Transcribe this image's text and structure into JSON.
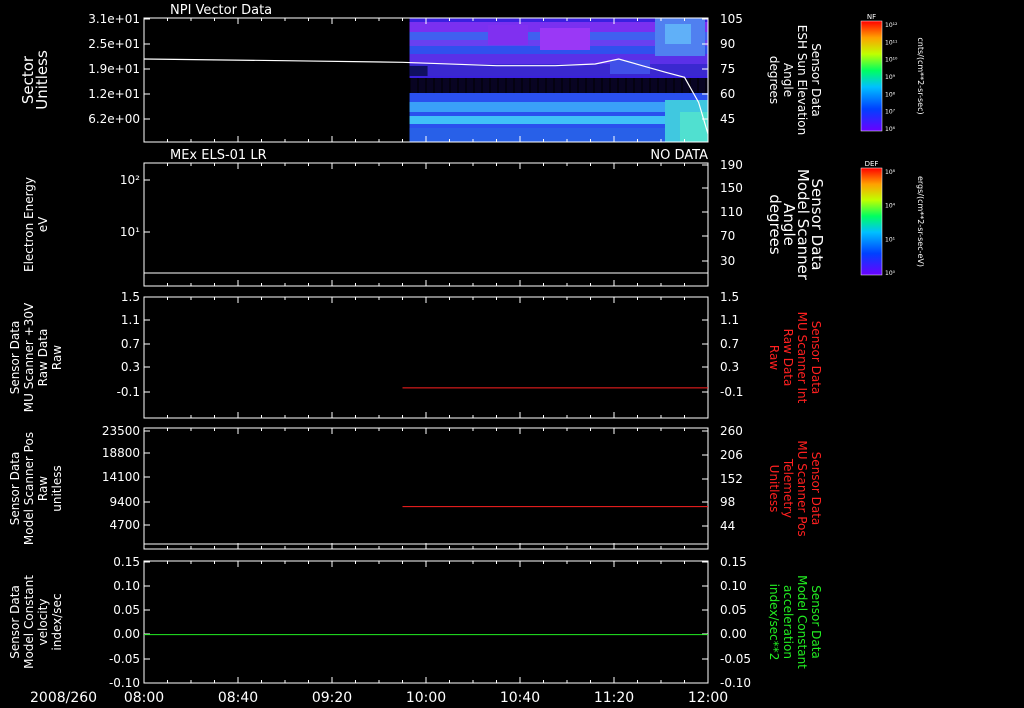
{
  "chart_data": [
    {
      "type": "heatmap",
      "title": "NPI Vector Data",
      "left_label": [
        "Sector",
        "Unitless"
      ],
      "right_label": [
        "Sensor Data",
        "ESH Sun Elevation",
        "Angle",
        "degrees"
      ],
      "left_ticks": [
        "3.1e+01",
        "2.5e+01",
        "1.9e+01",
        "1.2e+01",
        "6.2e+00"
      ],
      "right_ticks": [
        "105",
        "90",
        "75",
        "60",
        "45"
      ],
      "ylim_right": [
        30,
        105
      ],
      "overlay_line": {
        "name": "ESH Sun Elevation",
        "x": [
          "08:00",
          "09:00",
          "09:50",
          "10:30",
          "10:55",
          "11:12",
          "11:22",
          "11:32",
          "11:42",
          "11:50",
          "11:56",
          "12:00"
        ],
        "y": [
          81,
          80,
          79,
          77,
          77,
          78,
          81,
          77,
          73,
          70,
          55,
          36
        ],
        "color": "#ffffff"
      },
      "data_start": "09:53",
      "colorbar": {
        "label": "NF",
        "units": "cnts/(cm**2-sr-sec)",
        "ticks": [
          "10¹²",
          "10¹¹",
          "10¹⁰",
          "10⁹",
          "10⁸",
          "10⁷",
          "10⁶"
        ]
      }
    },
    {
      "type": "line",
      "title": "MEx ELS-01 LR",
      "status": "NO DATA",
      "left_label": [
        "Electron Energy",
        "eV"
      ],
      "right_label": [
        "Sensor Data",
        "Model Scanner",
        "Angle",
        "degrees"
      ],
      "left_ticks": [
        "10²",
        "10¹"
      ],
      "right_ticks": [
        "190",
        "150",
        "110",
        "70",
        "30"
      ],
      "ylim_right": [
        0,
        190
      ],
      "series": [
        {
          "x": [
            "08:00",
            "12:00"
          ],
          "y": [
            10,
            10
          ],
          "color": "#ffffff"
        }
      ],
      "colorbar": {
        "label": "DEF",
        "units": "ergs/(cm**2-sr-sec-eV)",
        "ticks": [
          "10⁸",
          "10⁴",
          "10¹",
          "10⁰"
        ]
      }
    },
    {
      "type": "line",
      "left_label": [
        "Sensor Data",
        "MU Scanner +30V",
        "Raw Data",
        "Raw"
      ],
      "right_label": [
        "Sensor Data",
        "MU Scanner Int",
        "Raw Data",
        "Raw"
      ],
      "right_label_color": "#ff2020",
      "left_ticks": [
        "1.5",
        "1.1",
        "0.7",
        "0.3",
        "-0.1"
      ],
      "right_ticks": [
        "1.5",
        "1.1",
        "0.7",
        "0.3",
        "-0.1"
      ],
      "ylim": [
        -0.35,
        1.5
      ],
      "series": [
        {
          "x": [
            "09:50",
            "12:00"
          ],
          "y": [
            -0.03,
            -0.03
          ],
          "color": "#ff2020"
        }
      ]
    },
    {
      "type": "line",
      "left_label": [
        "Sensor Data",
        "Model Scanner Pos",
        "Raw",
        "unitless"
      ],
      "right_label": [
        "Sensor Data",
        "MU Scanner Pos",
        "Telemetry",
        "Unitless"
      ],
      "right_label_color": "#ff2020",
      "left_ticks": [
        "23500",
        "18800",
        "14100",
        "9400",
        "4700"
      ],
      "right_ticks": [
        "260",
        "206",
        "152",
        "98",
        "44"
      ],
      "ylim_right": [
        -10,
        260
      ],
      "series": [
        {
          "x": [
            "09:50",
            "12:00"
          ],
          "y": [
            88,
            88
          ],
          "color": "#ff2020"
        }
      ]
    },
    {
      "type": "line",
      "left_label": [
        "Sensor Data",
        "Model Constant",
        "velocity",
        "index/sec"
      ],
      "right_label": [
        "Sensor Data",
        "Model Constant",
        "acceleration",
        "index/sec**2"
      ],
      "right_label_color": "#22ee22",
      "left_ticks": [
        "0.15",
        "0.10",
        "0.05",
        "0.00",
        "-0.05",
        "-0.10"
      ],
      "right_ticks": [
        "0.15",
        "0.10",
        "0.05",
        "0.00",
        "-0.05",
        "-0.10"
      ],
      "ylim": [
        -0.1,
        0.15
      ],
      "series": [
        {
          "x": [
            "08:00",
            "12:00"
          ],
          "y": [
            0.0,
            0.0
          ],
          "color": "#22ee22"
        }
      ]
    }
  ],
  "x_axis": {
    "date": "2008/260",
    "ticks": [
      "08:00",
      "08:40",
      "09:20",
      "10:00",
      "10:40",
      "11:20",
      "12:00"
    ]
  }
}
